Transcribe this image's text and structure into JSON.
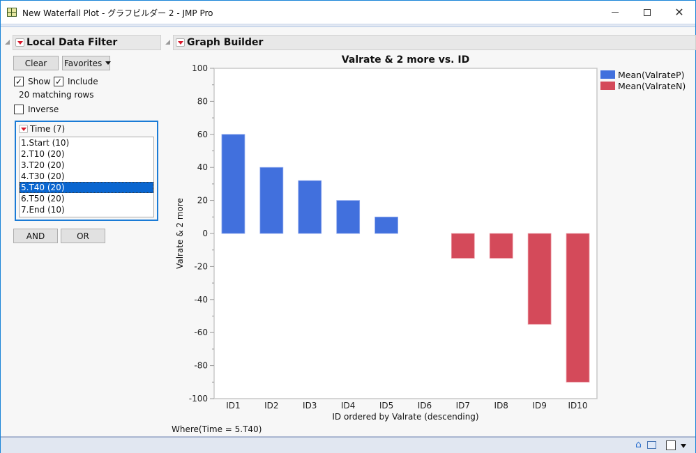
{
  "window": {
    "title": "New Waterfall Plot - グラフビルダー 2 - JMP Pro",
    "minimize_icon": "minimize-icon",
    "maximize_icon": "maximize-icon",
    "close_icon": "close-icon"
  },
  "filter_panel": {
    "header": "Local Data Filter",
    "clear_label": "Clear",
    "favorites_label": "Favorites",
    "show_label": "Show",
    "show_checked": true,
    "include_label": "Include",
    "include_checked": true,
    "matching_rows": "20 matching rows",
    "inverse_label": "Inverse",
    "inverse_checked": false,
    "column_header": "Time (7)",
    "items": [
      {
        "label": "1.Start (10)",
        "selected": false
      },
      {
        "label": "2.T10 (20)",
        "selected": false
      },
      {
        "label": "3.T20 (20)",
        "selected": false
      },
      {
        "label": "4.T30 (20)",
        "selected": false
      },
      {
        "label": "5.T40 (20)",
        "selected": true
      },
      {
        "label": "6.T50 (20)",
        "selected": false
      },
      {
        "label": "7.End (10)",
        "selected": false
      }
    ],
    "and_label": "AND",
    "or_label": "OR"
  },
  "graph_builder": {
    "header": "Graph Builder",
    "where_clause": "Where(Time = 5.T40)"
  },
  "colors": {
    "positive": "#4170dd",
    "negative": "#d44a5a",
    "selection": "#0a66d0"
  },
  "chart_data": {
    "type": "bar",
    "title": "Valrate & 2 more vs. ID",
    "xlabel": "ID ordered by Valrate (descending)",
    "ylabel": "Valrate & 2 more",
    "ylim": [
      -100,
      100
    ],
    "yticks": [
      100,
      80,
      60,
      40,
      20,
      0,
      -20,
      -40,
      -60,
      -80,
      -100
    ],
    "grid": false,
    "legend_position": "right",
    "categories": [
      "ID1",
      "ID2",
      "ID3",
      "ID4",
      "ID5",
      "ID6",
      "ID7",
      "ID8",
      "ID9",
      "ID10"
    ],
    "series": [
      {
        "name": "Mean(ValrateP)",
        "color": "#4170dd",
        "values": [
          60,
          40,
          32,
          20,
          10,
          null,
          null,
          null,
          null,
          null
        ]
      },
      {
        "name": "Mean(ValrateN)",
        "color": "#d44a5a",
        "values": [
          null,
          null,
          null,
          null,
          null,
          null,
          -15,
          -15,
          -55,
          -90
        ]
      }
    ]
  },
  "status_bar": {
    "home_icon": "home-icon",
    "table_icon": "data-table-icon",
    "selection_box_icon": "checkbox-icon",
    "dropdown_icon": "dropdown-arrow-icon"
  }
}
